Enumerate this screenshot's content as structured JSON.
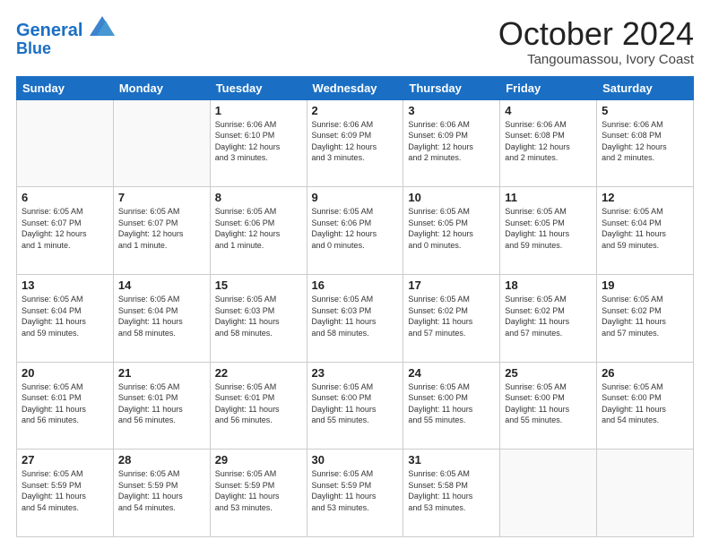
{
  "header": {
    "logo_line1": "General",
    "logo_line2": "Blue",
    "month": "October 2024",
    "location": "Tangoumassou, Ivory Coast"
  },
  "weekdays": [
    "Sunday",
    "Monday",
    "Tuesday",
    "Wednesday",
    "Thursday",
    "Friday",
    "Saturday"
  ],
  "weeks": [
    [
      {
        "day": "",
        "info": ""
      },
      {
        "day": "",
        "info": ""
      },
      {
        "day": "1",
        "info": "Sunrise: 6:06 AM\nSunset: 6:10 PM\nDaylight: 12 hours\nand 3 minutes."
      },
      {
        "day": "2",
        "info": "Sunrise: 6:06 AM\nSunset: 6:09 PM\nDaylight: 12 hours\nand 3 minutes."
      },
      {
        "day": "3",
        "info": "Sunrise: 6:06 AM\nSunset: 6:09 PM\nDaylight: 12 hours\nand 2 minutes."
      },
      {
        "day": "4",
        "info": "Sunrise: 6:06 AM\nSunset: 6:08 PM\nDaylight: 12 hours\nand 2 minutes."
      },
      {
        "day": "5",
        "info": "Sunrise: 6:06 AM\nSunset: 6:08 PM\nDaylight: 12 hours\nand 2 minutes."
      }
    ],
    [
      {
        "day": "6",
        "info": "Sunrise: 6:05 AM\nSunset: 6:07 PM\nDaylight: 12 hours\nand 1 minute."
      },
      {
        "day": "7",
        "info": "Sunrise: 6:05 AM\nSunset: 6:07 PM\nDaylight: 12 hours\nand 1 minute."
      },
      {
        "day": "8",
        "info": "Sunrise: 6:05 AM\nSunset: 6:06 PM\nDaylight: 12 hours\nand 1 minute."
      },
      {
        "day": "9",
        "info": "Sunrise: 6:05 AM\nSunset: 6:06 PM\nDaylight: 12 hours\nand 0 minutes."
      },
      {
        "day": "10",
        "info": "Sunrise: 6:05 AM\nSunset: 6:05 PM\nDaylight: 12 hours\nand 0 minutes."
      },
      {
        "day": "11",
        "info": "Sunrise: 6:05 AM\nSunset: 6:05 PM\nDaylight: 11 hours\nand 59 minutes."
      },
      {
        "day": "12",
        "info": "Sunrise: 6:05 AM\nSunset: 6:04 PM\nDaylight: 11 hours\nand 59 minutes."
      }
    ],
    [
      {
        "day": "13",
        "info": "Sunrise: 6:05 AM\nSunset: 6:04 PM\nDaylight: 11 hours\nand 59 minutes."
      },
      {
        "day": "14",
        "info": "Sunrise: 6:05 AM\nSunset: 6:04 PM\nDaylight: 11 hours\nand 58 minutes."
      },
      {
        "day": "15",
        "info": "Sunrise: 6:05 AM\nSunset: 6:03 PM\nDaylight: 11 hours\nand 58 minutes."
      },
      {
        "day": "16",
        "info": "Sunrise: 6:05 AM\nSunset: 6:03 PM\nDaylight: 11 hours\nand 58 minutes."
      },
      {
        "day": "17",
        "info": "Sunrise: 6:05 AM\nSunset: 6:02 PM\nDaylight: 11 hours\nand 57 minutes."
      },
      {
        "day": "18",
        "info": "Sunrise: 6:05 AM\nSunset: 6:02 PM\nDaylight: 11 hours\nand 57 minutes."
      },
      {
        "day": "19",
        "info": "Sunrise: 6:05 AM\nSunset: 6:02 PM\nDaylight: 11 hours\nand 57 minutes."
      }
    ],
    [
      {
        "day": "20",
        "info": "Sunrise: 6:05 AM\nSunset: 6:01 PM\nDaylight: 11 hours\nand 56 minutes."
      },
      {
        "day": "21",
        "info": "Sunrise: 6:05 AM\nSunset: 6:01 PM\nDaylight: 11 hours\nand 56 minutes."
      },
      {
        "day": "22",
        "info": "Sunrise: 6:05 AM\nSunset: 6:01 PM\nDaylight: 11 hours\nand 56 minutes."
      },
      {
        "day": "23",
        "info": "Sunrise: 6:05 AM\nSunset: 6:00 PM\nDaylight: 11 hours\nand 55 minutes."
      },
      {
        "day": "24",
        "info": "Sunrise: 6:05 AM\nSunset: 6:00 PM\nDaylight: 11 hours\nand 55 minutes."
      },
      {
        "day": "25",
        "info": "Sunrise: 6:05 AM\nSunset: 6:00 PM\nDaylight: 11 hours\nand 55 minutes."
      },
      {
        "day": "26",
        "info": "Sunrise: 6:05 AM\nSunset: 6:00 PM\nDaylight: 11 hours\nand 54 minutes."
      }
    ],
    [
      {
        "day": "27",
        "info": "Sunrise: 6:05 AM\nSunset: 5:59 PM\nDaylight: 11 hours\nand 54 minutes."
      },
      {
        "day": "28",
        "info": "Sunrise: 6:05 AM\nSunset: 5:59 PM\nDaylight: 11 hours\nand 54 minutes."
      },
      {
        "day": "29",
        "info": "Sunrise: 6:05 AM\nSunset: 5:59 PM\nDaylight: 11 hours\nand 53 minutes."
      },
      {
        "day": "30",
        "info": "Sunrise: 6:05 AM\nSunset: 5:59 PM\nDaylight: 11 hours\nand 53 minutes."
      },
      {
        "day": "31",
        "info": "Sunrise: 6:05 AM\nSunset: 5:58 PM\nDaylight: 11 hours\nand 53 minutes."
      },
      {
        "day": "",
        "info": ""
      },
      {
        "day": "",
        "info": ""
      }
    ]
  ]
}
